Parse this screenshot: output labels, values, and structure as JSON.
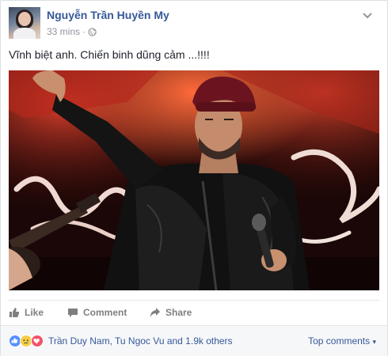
{
  "post": {
    "author_name": "Nguyễn Trần Huyền My",
    "timestamp": "33 mins",
    "separator": "·",
    "privacy_icon": "globe-icon",
    "text": "Vĩnh biệt anh. Chiến binh dũng cảm ...!!!!"
  },
  "actions": {
    "like_label": "Like",
    "comment_label": "Comment",
    "share_label": "Share"
  },
  "summary": {
    "reactions": [
      "like-icon",
      "sad-icon",
      "love-icon"
    ],
    "likers_text": "Trần Duy Nam, Tu Ngoc Vu and 1.9k others",
    "sort_label": "Top comments",
    "sort_caret": "▾"
  },
  "colors": {
    "link_blue": "#365899",
    "meta_gray": "#90949c",
    "action_gray": "#7f7f7f",
    "like_blue": "#5890ff",
    "sad_yellow": "#f7cd46",
    "love_red": "#f25268"
  }
}
